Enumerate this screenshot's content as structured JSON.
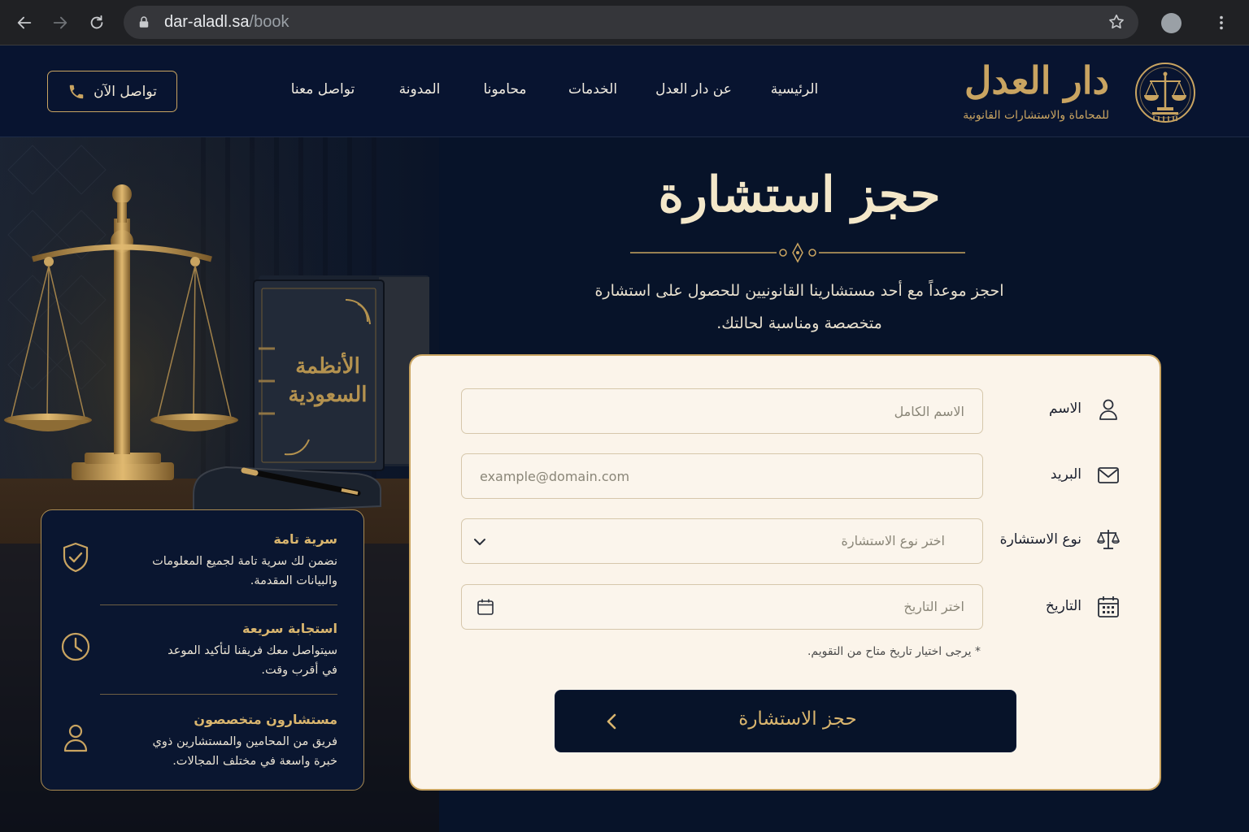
{
  "browser": {
    "url_host": "dar-aladl.sa",
    "url_path": "/book"
  },
  "header": {
    "brand_title": "دار العدل",
    "brand_subtitle": "للمحاماة والاستشارات القانونية",
    "nav": [
      "الرئيسية",
      "عن دار العدل",
      "الخدمات",
      "محامونا",
      "المدونة",
      "تواصل معنا"
    ],
    "contact_button": "تواصل الآن"
  },
  "hero": {
    "book_title_line1": "الأنظمة",
    "book_title_line2": "السعودية"
  },
  "features": [
    {
      "title": "سرية تامة",
      "desc_line1": "نضمن لك سرية تامة لجميع المعلومات",
      "desc_line2": "والبيانات المقدمة.",
      "icon": "shield-check-icon"
    },
    {
      "title": "استجابة سريعة",
      "desc_line1": "سيتواصل معك فريقنا لتأكيد الموعد",
      "desc_line2": "في أقرب وقت.",
      "icon": "clock-icon"
    },
    {
      "title": "مستشارون متخصصون",
      "desc_line1": "فريق من المحامين والمستشارين ذوي",
      "desc_line2": "خبرة واسعة في مختلف المجالات.",
      "icon": "user-icon"
    }
  ],
  "page": {
    "title": "حجز استشارة",
    "subtitle_line1": "احجز موعداً مع أحد مستشارينا القانونيين للحصول على استشارة",
    "subtitle_line2": "متخصصة ومناسبة لحالتك."
  },
  "form": {
    "name_label": "الاسم",
    "name_placeholder": "الاسم الكامل",
    "email_label": "البريد",
    "email_placeholder": "example@domain.com",
    "type_label": "نوع الاستشارة",
    "type_placeholder": "اختر نوع الاستشارة",
    "date_label": "التاريخ",
    "date_placeholder": "اختر التاريخ",
    "hint": "* يرجى اختيار تاريخ متاح من التقويم.",
    "submit": "حجز الاستشارة"
  },
  "colors": {
    "background": "#071329",
    "gold": "#c9a461",
    "card": "#fbf4ea"
  }
}
